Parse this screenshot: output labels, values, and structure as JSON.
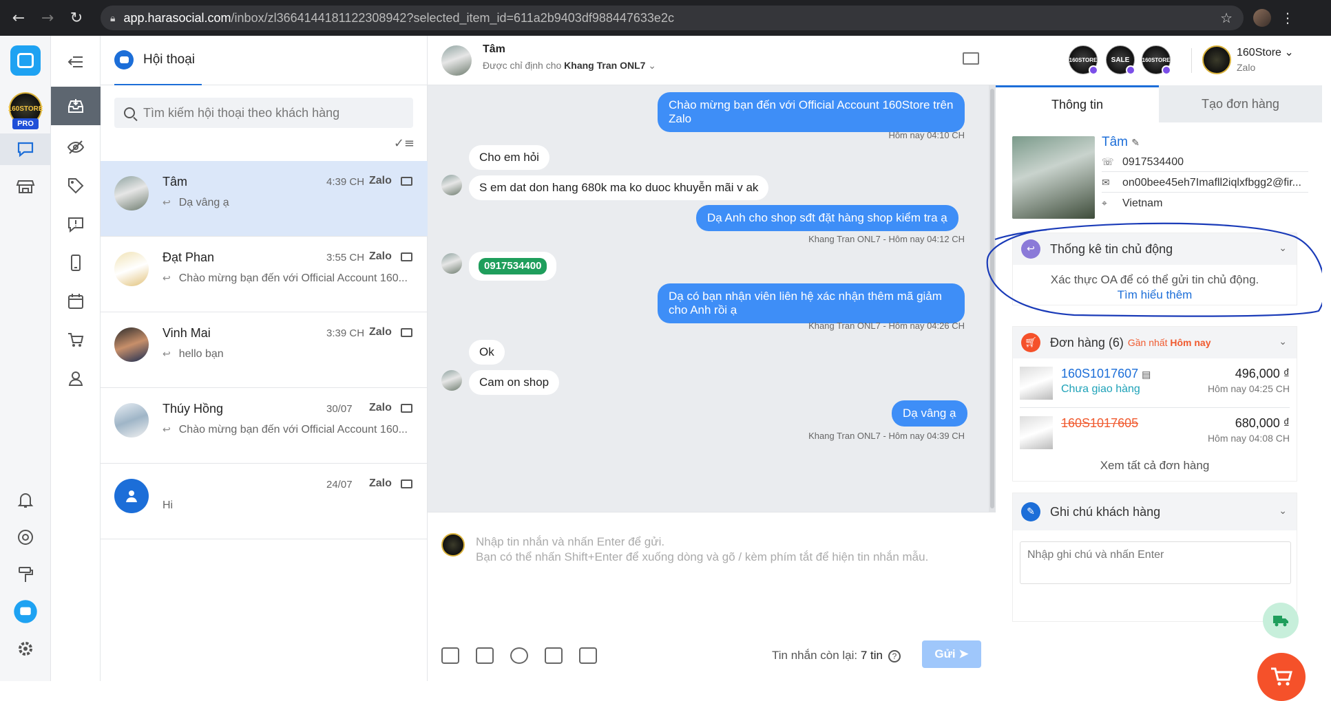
{
  "browser": {
    "url_host": "app.harasocial.com",
    "url_path": "/inbox/zl3664144181122308942?selected_item_id=611a2b9403df988447633e2c"
  },
  "rail": {
    "pro_badge": "PRO",
    "store_logo_text": "160STORE"
  },
  "conversations": {
    "tab_label": "Hội thoại",
    "search_placeholder": "Tìm kiếm hội thoại theo khách hàng",
    "items": [
      {
        "name": "Tâm",
        "time": "4:39 CH",
        "source": "Zalo",
        "preview": "Dạ vâng ạ",
        "replied": true
      },
      {
        "name": "Đạt Phan",
        "time": "3:55 CH",
        "source": "Zalo",
        "preview": "Chào mừng bạn đến với Official Account 160...",
        "replied": true
      },
      {
        "name": "Vinh Mai",
        "time": "3:39 CH",
        "source": "Zalo",
        "preview": "hello bạn",
        "replied": true
      },
      {
        "name": "Thúy Hồng",
        "time": "30/07",
        "source": "Zalo",
        "preview": "Chào mừng bạn đến với Official Account 160...",
        "replied": true
      },
      {
        "name": "",
        "time": "24/07",
        "source": "Zalo",
        "preview": "Hi",
        "replied": false
      }
    ]
  },
  "chat": {
    "contact_name": "Tâm",
    "assigned_prefix": "Được chỉ định cho",
    "assigned_to": "Khang Tran ONL7",
    "messages": [
      {
        "dir": "out",
        "text": "Chào mừng bạn đến với Official Account 160Store trên Zalo",
        "meta": "Hôm nay 04:10 CH"
      },
      {
        "dir": "in",
        "text": "Cho em hỏi"
      },
      {
        "dir": "in",
        "text": "S em dat don hang 680k ma ko duoc khuyễn mãi v ak"
      },
      {
        "dir": "out",
        "text": "Dạ Anh cho shop sđt đặt hàng shop kiểm tra ạ",
        "meta": "Khang Tran ONL7 - Hôm nay 04:12 CH"
      },
      {
        "dir": "in",
        "text": "0917534400"
      },
      {
        "dir": "out",
        "text": "Dạ có bạn nhận viên liên hệ xác nhận thêm mã giảm cho Anh rồi ạ",
        "meta": "Khang Tran ONL7 - Hôm nay 04:26 CH"
      },
      {
        "dir": "in",
        "text": "Ok"
      },
      {
        "dir": "in",
        "text": "Cam on shop"
      },
      {
        "dir": "out",
        "text": "Dạ vâng ạ",
        "meta": "Khang Tran ONL7 - Hôm nay 04:39 CH"
      }
    ],
    "composer_placeholder_1": "Nhập tin nhắn và nhấn Enter để gửi.",
    "composer_placeholder_2": "Bạn có thể nhấn Shift+Enter để xuống dòng và gõ / kèm phím tắt để hiện tin nhắn mẫu.",
    "remaining_label": "Tin nhắn còn lại:",
    "remaining_value": "7 tin",
    "send_label": "Gửi"
  },
  "topbar": {
    "channels": [
      "160STORE",
      "SALE",
      "160STORE"
    ],
    "store_name": "160Store",
    "store_channel": "Zalo"
  },
  "right": {
    "tab_info": "Thông tin",
    "tab_order": "Tạo đơn hàng",
    "profile": {
      "name": "Tâm",
      "phone": "0917534400",
      "email": "on00bee45eh7Imafll2iqlxfbgg2@fir...",
      "country": "Vietnam"
    },
    "stats": {
      "title": "Thống kê tin chủ động",
      "body": "Xác thực OA để có thể gửi tin chủ động.",
      "link": "Tìm hiểu thêm"
    },
    "orders": {
      "title": "Đơn hàng (6)",
      "recent_prefix": "Gần nhất",
      "recent_value": "Hôm nay",
      "items": [
        {
          "code": "160S1017607",
          "status": "Chưa giao hàng",
          "amount": "496,000 ₫",
          "time": "Hôm nay 04:25 CH",
          "cancelled": false
        },
        {
          "code": "160S1017605",
          "status": "",
          "amount": "680,000 ₫",
          "time": "Hôm nay 04:08 CH",
          "cancelled": true
        }
      ],
      "view_all": "Xem tất cả đơn hàng"
    },
    "notes": {
      "title": "Ghi chú khách hàng",
      "placeholder": "Nhập ghi chú và nhấn Enter"
    }
  },
  "colors": {
    "accent": "#1c6ed8",
    "bubble_out": "#3e8ef7",
    "order_icon": "#f5512a",
    "annotation": "#1a3bb8"
  }
}
